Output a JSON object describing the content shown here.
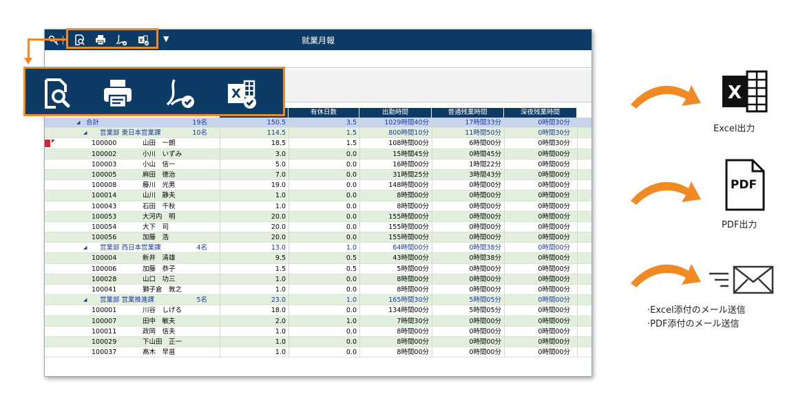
{
  "window": {
    "title": "就業月報",
    "toolbar": {
      "icons": [
        "key-icon",
        "preview-icon",
        "print-icon",
        "pdf-icon",
        "excel-icon",
        "dropdown-icon"
      ],
      "dropdown_glyph": "▼"
    }
  },
  "table": {
    "headers": [
      "",
      "",
      "有休日数",
      "出勤時間",
      "普通残業時間",
      "深夜残業時間"
    ],
    "total": {
      "toggle": "◢",
      "label": "合計",
      "count": "19名",
      "days": "150.5",
      "paid": "3.5",
      "work": "1029時間40分",
      "ot": "17時間33分",
      "night": "0時間30分"
    },
    "groups": [
      {
        "toggle": "◢",
        "label": "営業部 東日本営業課",
        "count": "10名",
        "days": "114.5",
        "paid": "1.5",
        "work": "800時間10分",
        "ot": "11時間50分",
        "night": "0時間30分",
        "rows": [
          {
            "code": "100000",
            "name": "山田　一朗",
            "days": "18.5",
            "paid": "1.5",
            "work": "108時間00分",
            "ot": "6時間00分",
            "night": "0時間30分"
          },
          {
            "code": "100002",
            "name": "小川　いずみ",
            "days": "3.0",
            "paid": "0.0",
            "work": "15時間45分",
            "ot": "0時間45分",
            "night": "0時間00分"
          },
          {
            "code": "100003",
            "name": "小山　信一",
            "days": "5.0",
            "paid": "0.0",
            "work": "16時間00分",
            "ot": "1時間22分",
            "night": "0時間00分"
          },
          {
            "code": "100005",
            "name": "麻田　徳治",
            "days": "7.0",
            "paid": "0.0",
            "work": "31時間25分",
            "ot": "3時間43分",
            "night": "0時間00分"
          },
          {
            "code": "100008",
            "name": "藤川　光男",
            "days": "19.0",
            "paid": "0.0",
            "work": "148時間00分",
            "ot": "0時間00分",
            "night": "0時間00分"
          },
          {
            "code": "100014",
            "name": "山川　静夫",
            "days": "1.0",
            "paid": "0.0",
            "work": "8時間00分",
            "ot": "0時間00分",
            "night": "0時間00分"
          },
          {
            "code": "100043",
            "name": "石田　千秋",
            "days": "1.0",
            "paid": "0.0",
            "work": "8時間00分",
            "ot": "0時間00分",
            "night": "0時間00分"
          },
          {
            "code": "100053",
            "name": "大河内　明",
            "days": "20.0",
            "paid": "0.0",
            "work": "155時間00分",
            "ot": "0時間00分",
            "night": "0時間00分"
          },
          {
            "code": "100054",
            "name": "大下　司",
            "days": "20.0",
            "paid": "0.0",
            "work": "155時間00分",
            "ot": "0時間00分",
            "night": "0時間00分"
          },
          {
            "code": "100056",
            "name": "加藤　浩",
            "days": "20.0",
            "paid": "0.0",
            "work": "155時間00分",
            "ot": "0時間00分",
            "night": "0時間00分"
          }
        ]
      },
      {
        "toggle": "◢",
        "label": "営業部 西日本営業課",
        "count": "4名",
        "days": "13.0",
        "paid": "1.0",
        "work": "64時間00分",
        "ot": "0時間38分",
        "night": "0時間00分",
        "rows": [
          {
            "code": "100004",
            "name": "新井　清雄",
            "days": "9.5",
            "paid": "0.5",
            "work": "43時間00分",
            "ot": "0時間38分",
            "night": "0時間00分"
          },
          {
            "code": "100006",
            "name": "加藤　恭子",
            "days": "1.5",
            "paid": "0.5",
            "work": "5時間00分",
            "ot": "0時間00分",
            "night": "0時間00分"
          },
          {
            "code": "100028",
            "name": "山口　功三",
            "days": "1.0",
            "paid": "0.0",
            "work": "8時間00分",
            "ot": "0時間00分",
            "night": "0時間00分"
          },
          {
            "code": "100041",
            "name": "獅子倉　敦之",
            "days": "1.0",
            "paid": "0.0",
            "work": "8時間00分",
            "ot": "0時間00分",
            "night": "0時間00分"
          }
        ]
      },
      {
        "toggle": "◢",
        "label": "営業部 営業推進課",
        "count": "5名",
        "days": "23.0",
        "paid": "1.0",
        "work": "165時間30分",
        "ot": "5時間05分",
        "night": "0時間00分",
        "rows": [
          {
            "code": "100001",
            "name": "川谷　しげる",
            "days": "18.0",
            "paid": "0.0",
            "work": "134時間00分",
            "ot": "5時間05分",
            "night": "0時間00分"
          },
          {
            "code": "100007",
            "name": "田中　敏夫",
            "days": "2.0",
            "paid": "1.0",
            "work": "7時間30分",
            "ot": "0時間00分",
            "night": "0時間00分"
          },
          {
            "code": "100011",
            "name": "政岡　信夫",
            "days": "1.0",
            "paid": "0.0",
            "work": "8時間00分",
            "ot": "0時間00分",
            "night": "0時間00分"
          },
          {
            "code": "100029",
            "name": "下山田　正一",
            "days": "1.0",
            "paid": "0.0",
            "work": "8時間00分",
            "ot": "0時間00分",
            "night": "0時間00分"
          },
          {
            "code": "100037",
            "name": "高木　早苗",
            "days": "1.0",
            "paid": "0.0",
            "work": "8時間00分",
            "ot": "0時間00分",
            "night": "0時間00分"
          }
        ]
      }
    ]
  },
  "features": {
    "excel_label": "Excel出力",
    "pdf_label": "PDF出力",
    "pdf_icon_text": "PDF",
    "excel_icon_text": "X",
    "mail_line1": "·Excel添付のメール送信",
    "mail_line2": "·PDF添付のメール送信"
  },
  "colors": {
    "titlebar": "#0d3b66",
    "accent_orange": "#f08a24",
    "total_row": "#c8d3ec",
    "alt_row": "#e3efdd",
    "group_text": "#1a3a9e"
  }
}
